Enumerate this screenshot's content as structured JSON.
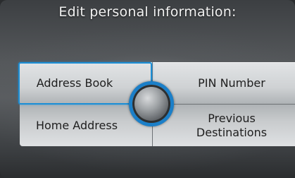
{
  "title": "Edit personal information:",
  "menu": {
    "address_book": "Address Book",
    "pin_number": "PIN Number",
    "home_address": "Home Address",
    "previous_destinations": "Previous\nDestinations"
  },
  "colors": {
    "selection_highlight": "#1c8fd6",
    "panel": "#cfd2d4",
    "background": "#55585b"
  },
  "icons": {
    "center": "joystick-knob-icon"
  }
}
